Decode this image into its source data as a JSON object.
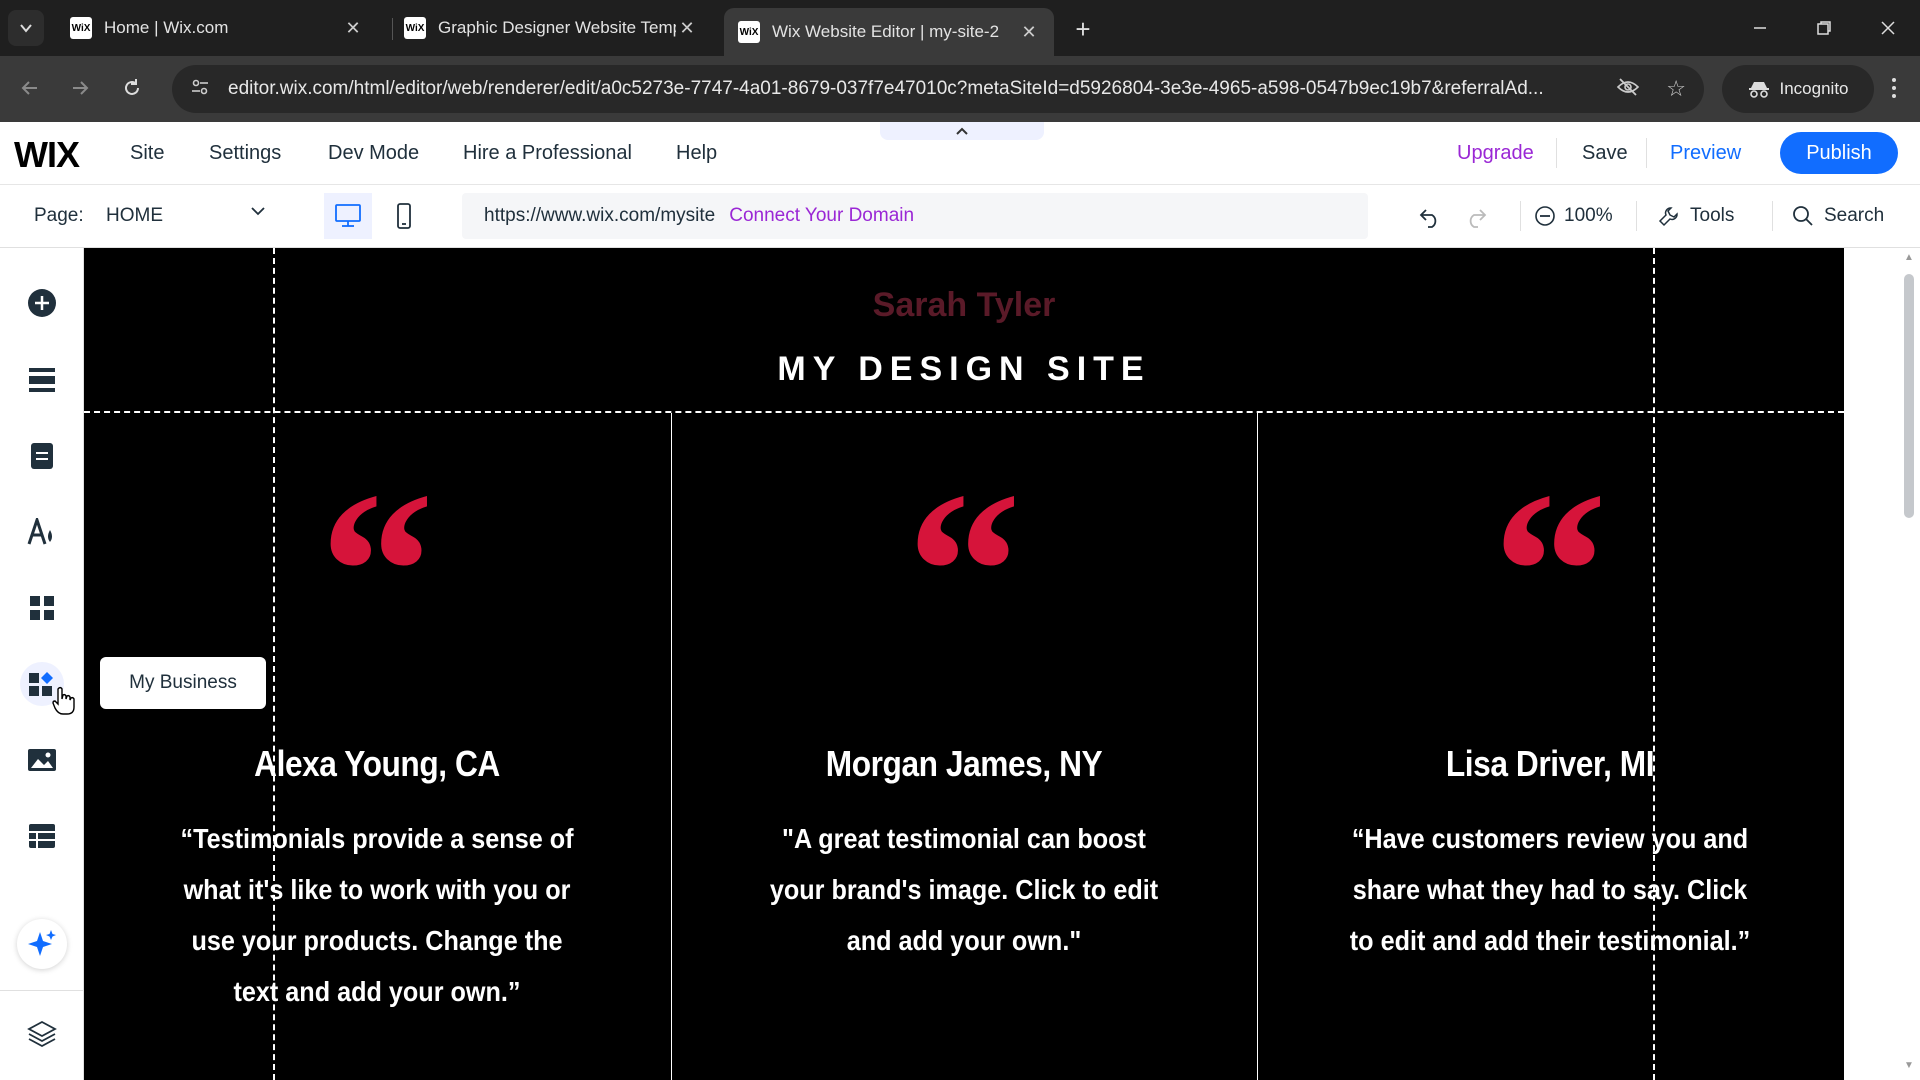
{
  "browser": {
    "tabs": [
      {
        "title": "Home | Wix.com",
        "favicon": "WiX",
        "active": false
      },
      {
        "title": "Graphic Designer Website Temp",
        "favicon": "WiX",
        "active": false
      },
      {
        "title": "Wix Website Editor | my-site-2",
        "favicon": "WiX",
        "active": true
      }
    ],
    "url": "editor.wix.com/html/editor/web/renderer/edit/a0c5273e-7747-4a01-8679-037f7e47010c?metaSiteId=d5926804-3e3e-4965-a598-0547b9ec19b7&referralAd...",
    "incognito_label": "Incognito"
  },
  "editor": {
    "logo": "WIX",
    "menu": [
      "Site",
      "Settings",
      "Dev Mode",
      "Hire a Professional",
      "Help"
    ],
    "upgrade": "Upgrade",
    "save": "Save",
    "preview": "Preview",
    "publish": "Publish",
    "page_label": "Page:",
    "page_value": "HOME",
    "site_url": "https://www.wix.com/mysite",
    "connect_domain": "Connect Your Domain",
    "zoom": "100%",
    "tools": "Tools",
    "search": "Search"
  },
  "sidebar": {
    "tooltip": "My Business",
    "icons": [
      "add-icon",
      "sections-icon",
      "pages-icon",
      "design-icon",
      "apps-icon",
      "my-business-icon",
      "media-icon",
      "cms-icon",
      "ai-assistant-icon",
      "layers-icon"
    ]
  },
  "site": {
    "owner": "Sarah Tyler",
    "title": "MY DESIGN SITE",
    "quote_glyph": "“",
    "testimonials": [
      {
        "name": "Alexa Young, CA",
        "text": "“Testimonials provide a sense of what it's like to work with you or use your products. Change the text and add your own.”"
      },
      {
        "name": "Morgan James, NY",
        "text": "\"A great testimonial can boost your brand's image. Click to edit and add your own.\""
      },
      {
        "name": "Lisa Driver, MI",
        "text": "“Have customers review you and share what they had to say. Click to edit and add their testimonial.”"
      }
    ]
  },
  "colors": {
    "accent_blue": "#116dff",
    "upgrade_purple": "#9a27d5",
    "quote_red": "#d6143a",
    "owner_text": "#5a1a28"
  }
}
